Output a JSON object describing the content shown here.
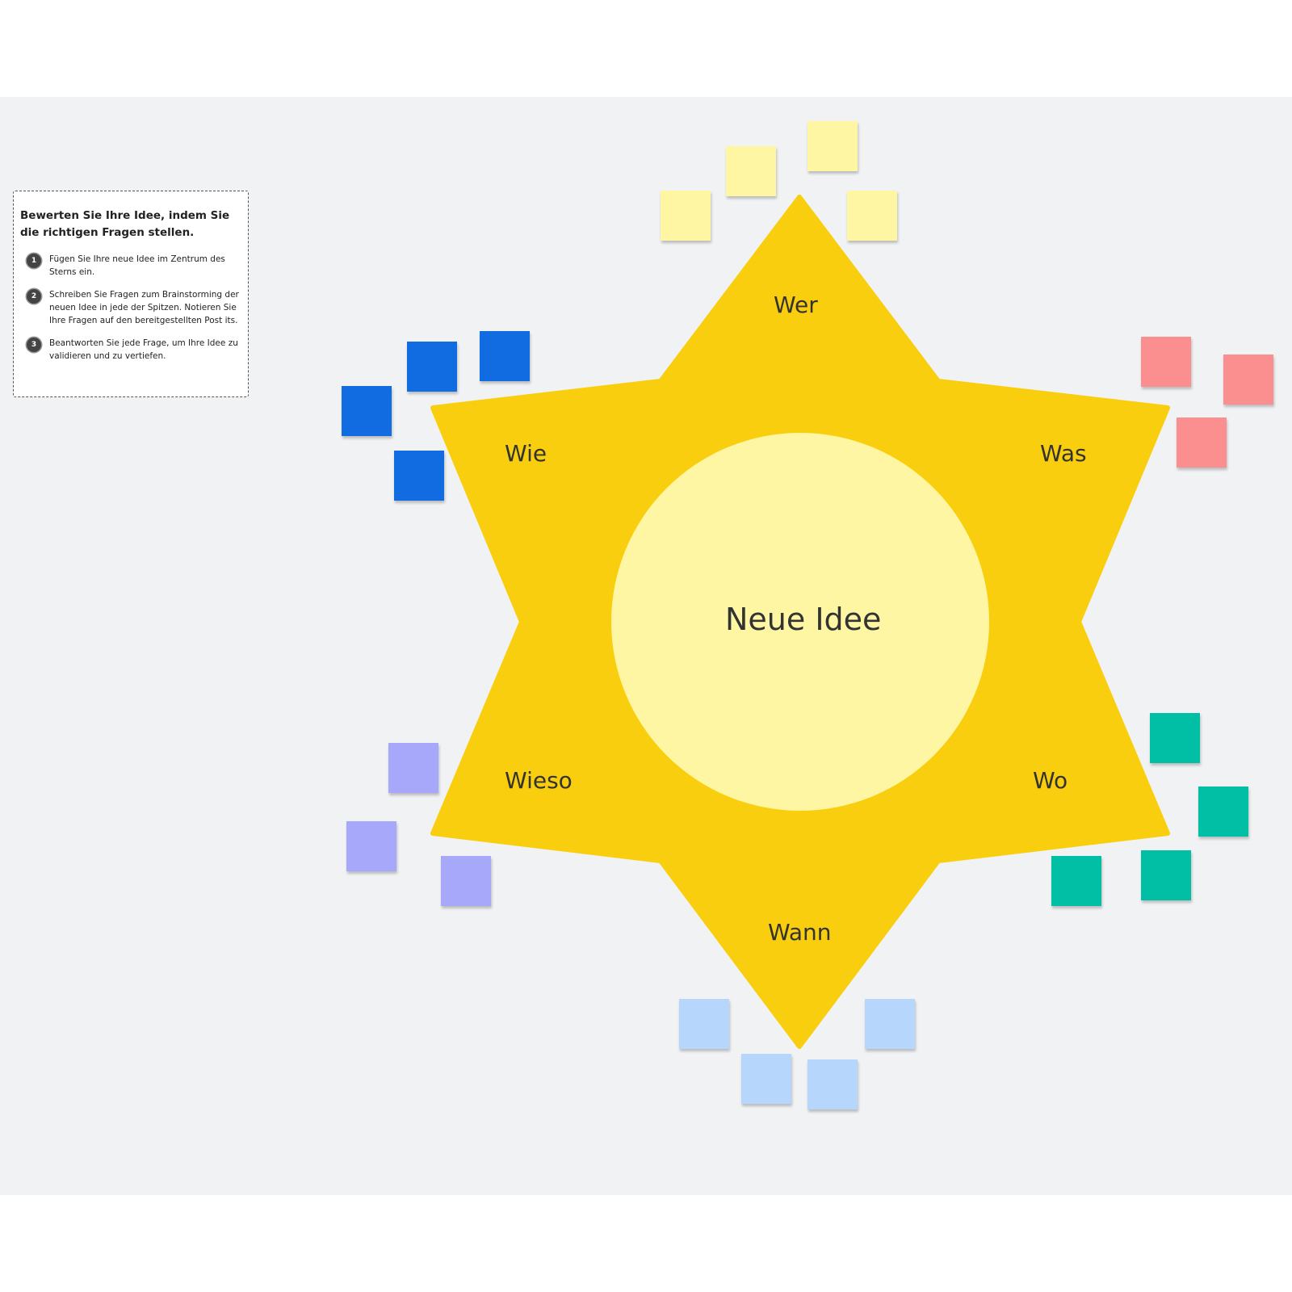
{
  "instructions": {
    "title": "Bewerten Sie Ihre Idee, indem Sie die richtigen Fragen stellen.",
    "steps": [
      {
        "number": "1",
        "text": "Fügen Sie Ihre neue Idee im Zentrum des Sterns ein."
      },
      {
        "number": "2",
        "text": "Schreiben Sie Fragen zum Brainstorming der neuen Idee in jede der Spitzen. Notieren Sie Ihre Fragen auf den bereitgestellten Post its."
      },
      {
        "number": "3",
        "text": "Beantworten Sie jede Frage, um Ihre Idee zu validieren und zu vertiefen."
      }
    ]
  },
  "star": {
    "center_label": "Neue Idee",
    "points": {
      "top": "Wer",
      "upper_right": "Was",
      "lower_right": "Wo",
      "bottom": "Wann",
      "lower_left": "Wieso",
      "upper_left": "Wie"
    }
  },
  "colors": {
    "board": "#f1f2f4",
    "star": "#f9ce0e",
    "center": "#fff6a3",
    "sticky_wer": "#fff6a3",
    "sticky_was": "#fb8f8f",
    "sticky_wo": "#00bfa5",
    "sticky_wann": "#b6d6fc",
    "sticky_wieso": "#a8a8fa",
    "sticky_wie": "#106ce0"
  }
}
